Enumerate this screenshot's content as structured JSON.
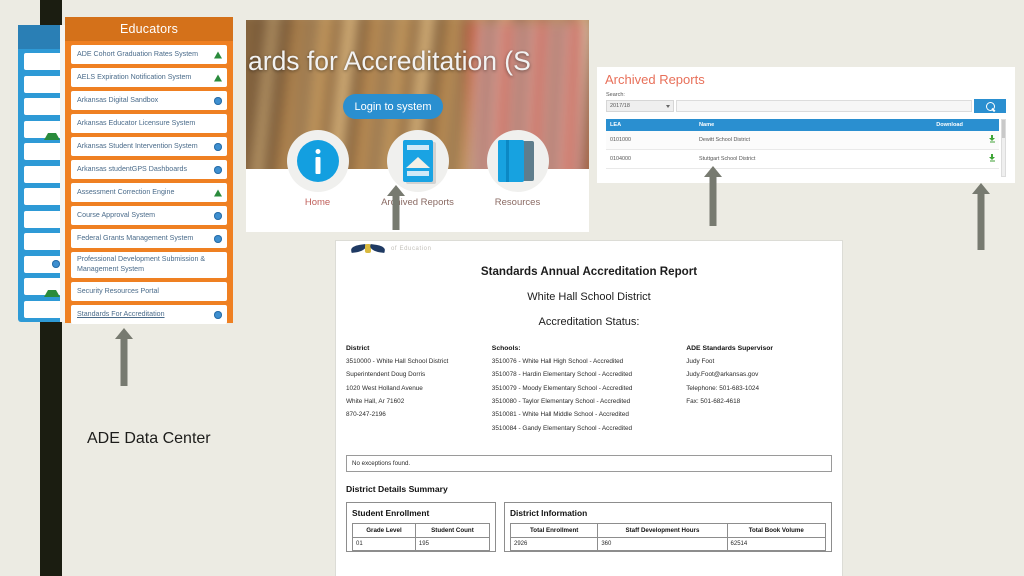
{
  "caption": "ADE Data Center",
  "left_nav_panel": {
    "name": "partial-blue-nav-panel",
    "row_icons": [
      "none",
      "none",
      "none",
      "triangle",
      "none",
      "none",
      "none",
      "none",
      "none",
      "globe",
      "triangle",
      "none"
    ]
  },
  "educators": {
    "header": "Educators",
    "items": [
      {
        "label": "ADE Cohort Graduation Rates System",
        "icon": "triangle-icon",
        "active": false
      },
      {
        "label": "AELS Expiration Notification System",
        "icon": "triangle-icon",
        "active": false
      },
      {
        "label": "Arkansas Digital Sandbox",
        "icon": "globe-icon",
        "active": false
      },
      {
        "label": "Arkansas Educator Licensure System",
        "icon": "none",
        "active": false
      },
      {
        "label": "Arkansas Student Intervention System",
        "icon": "globe-icon",
        "active": false
      },
      {
        "label": "Arkansas studentGPS Dashboards",
        "icon": "globe-icon",
        "active": false
      },
      {
        "label": "Assessment Correction Engine",
        "icon": "triangle-icon",
        "active": false
      },
      {
        "label": "Course Approval System",
        "icon": "globe-icon",
        "active": false
      },
      {
        "label": "Federal Grants Management System",
        "icon": "globe-icon",
        "active": false
      },
      {
        "label": "Professional Development Submission & Management System",
        "icon": "none",
        "active": false
      },
      {
        "label": "Security Resources Portal",
        "icon": "none",
        "active": false
      },
      {
        "label": "Standards For Accreditation",
        "icon": "globe-icon",
        "active": true
      }
    ]
  },
  "hero": {
    "title": "ards for Accreditation (S",
    "login_button": "Login to system",
    "icons": [
      {
        "label": "Home",
        "icon": "info-icon"
      },
      {
        "label": "Archived Reports",
        "icon": "document-icon"
      },
      {
        "label": "Resources",
        "icon": "books-icon"
      }
    ]
  },
  "archived": {
    "title": "Archived Reports",
    "search_label": "Search:",
    "year_selected": "2017/18",
    "search_value": "",
    "search_button_icon": "search-icon",
    "columns": [
      "LEA",
      "Name",
      "Download"
    ],
    "rows": [
      {
        "lea": "0101000",
        "name": "Dewitt School District",
        "download": "download-icon"
      },
      {
        "lea": "0104000",
        "name": "Stuttgart School District",
        "download": "download-icon"
      }
    ]
  },
  "report": {
    "logo_text": "of Education",
    "title": "Standards Annual Accreditation Report",
    "district_name": "White Hall School District",
    "status_label": "Accreditation Status:",
    "district": {
      "heading": "District",
      "lines": [
        "3510000 - White Hall School District",
        "Superintendent Doug Dorris",
        "1020 West Holland Avenue",
        "White Hall, Ar 71602",
        "870-247-2196"
      ]
    },
    "schools": {
      "heading": "Schools:",
      "lines": [
        "3510076 - White Hall High School - Accredited",
        "3510078 - Hardin Elementary School - Accredited",
        "3510079 - Moody Elementary School - Accredited",
        "3510080 - Taylor Elementary School - Accredited",
        "3510081 - White Hall Middle School - Accredited",
        "3510084 - Gandy Elementary School - Accredited"
      ]
    },
    "supervisor": {
      "heading": "ADE Standards Supervisor",
      "lines": [
        "Judy Foot",
        "Judy.Foot@arkansas.gov",
        "Telephone: 501-683-1024",
        "Fax: 501-682-4618"
      ]
    },
    "exceptions": "No exceptions found.",
    "summary_title": "District Details Summary",
    "student_enrollment": {
      "title": "Student Enrollment",
      "columns": [
        "Grade Level",
        "Student Count"
      ],
      "rows": [
        [
          "01",
          "195"
        ]
      ]
    },
    "district_information": {
      "title": "District Information",
      "columns": [
        "Total Enrollment",
        "Staff Development Hours",
        "Total Book Volume"
      ],
      "rows": [
        [
          "2926",
          "360",
          "62514"
        ]
      ]
    }
  },
  "colors": {
    "page_background": "#ecebe3",
    "dark_stripe": "#1b1d11",
    "orange_panel": "#ef8022",
    "orange_header": "#d4711a",
    "blue_accent": "#2a8fd0",
    "archived_title": "#e8705a",
    "home_label": "#c0615c",
    "arrow_gray": "#777a70",
    "green_icon": "#2a8b3c"
  }
}
